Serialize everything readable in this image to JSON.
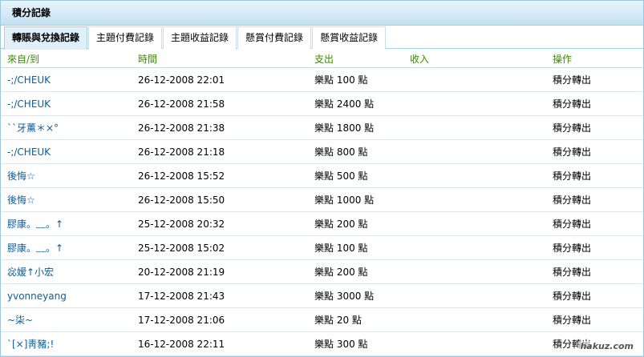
{
  "title": "積分記錄",
  "tabs": [
    {
      "label": "轉賬與兌換記錄",
      "active": true
    },
    {
      "label": "主題付費記錄",
      "active": false
    },
    {
      "label": "主題收益記錄",
      "active": false
    },
    {
      "label": "懸賞付費記錄",
      "active": false
    },
    {
      "label": "懸賞收益記錄",
      "active": false
    }
  ],
  "table": {
    "headers": [
      "來自/到",
      "時間",
      "支出",
      "收入",
      "操作"
    ],
    "rows": [
      {
        "from": "-;/CHEUK",
        "time": "26-12-2008 22:01",
        "out": "樂點 100 點",
        "in": "",
        "action": "積分轉出"
      },
      {
        "from": "-;/CHEUK",
        "time": "26-12-2008 21:58",
        "out": "樂點 2400 點",
        "in": "",
        "action": "積分轉出"
      },
      {
        "from": "``牙薰＊×°",
        "time": "26-12-2008 21:38",
        "out": "樂點 1800 點",
        "in": "",
        "action": "積分轉出"
      },
      {
        "from": "-;/CHEUK",
        "time": "26-12-2008 21:18",
        "out": "樂點 800 點",
        "in": "",
        "action": "積分轉出"
      },
      {
        "from": "後悔☆",
        "time": "26-12-2008 15:52",
        "out": "樂點 500 點",
        "in": "",
        "action": "積分轉出"
      },
      {
        "from": "後悔☆",
        "time": "26-12-2008 15:50",
        "out": "樂點 1000 點",
        "in": "",
        "action": "積分轉出"
      },
      {
        "from": "膠康。﹏。↑",
        "time": "25-12-2008 20:32",
        "out": "樂點 200 點",
        "in": "",
        "action": "積分轉出"
      },
      {
        "from": "膠康。﹏。↑",
        "time": "25-12-2008 15:02",
        "out": "樂點 100 點",
        "in": "",
        "action": "積分轉出"
      },
      {
        "from": "惢嫒↑小宏",
        "time": "20-12-2008 21:19",
        "out": "樂點 200 點",
        "in": "",
        "action": "積分轉出"
      },
      {
        "from": "yvonneyang",
        "time": "17-12-2008 21:43",
        "out": "樂點 3000 點",
        "in": "",
        "action": "積分轉出"
      },
      {
        "from": "~柒~",
        "time": "17-12-2008 21:06",
        "out": "樂點 20 點",
        "in": "",
        "action": "積分轉出"
      },
      {
        "from": "`[×]靑豬;!",
        "time": "16-12-2008 22:11",
        "out": "樂點 300 點",
        "in": "",
        "action": "積分轉出"
      }
    ]
  },
  "watermark": "hakuz.com"
}
